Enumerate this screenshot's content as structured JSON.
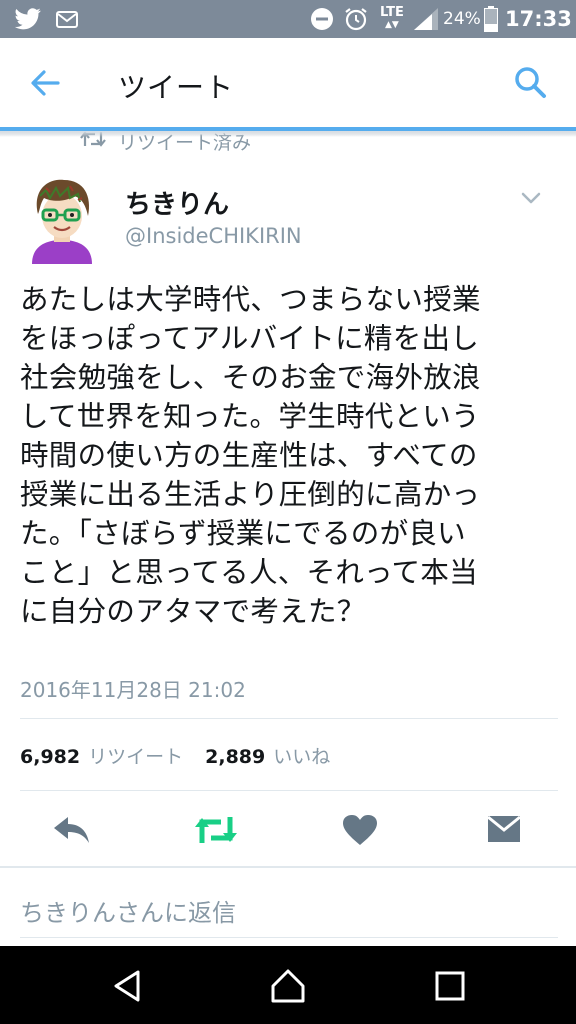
{
  "status_bar": {
    "network": "LTE",
    "battery_percent": "24%",
    "time": "17:33",
    "icons": [
      "twitter-icon",
      "mail-notification-icon",
      "do-not-disturb-icon",
      "alarm-icon",
      "signal-icon",
      "battery-icon"
    ]
  },
  "app_bar": {
    "title": "ツイート",
    "back_icon": "arrow-left-icon",
    "search_icon": "search-icon",
    "accent_color": "#55acee"
  },
  "retweet_context": {
    "label": "リツイート済み"
  },
  "tweet": {
    "author_name": "ちきりん",
    "author_handle": "@InsideCHIKIRIN",
    "text": "あたしは大学時代、つまらない授業\nをほっぽってアルバイトに精を出し\n社会勉強をし、そのお金で海外放浪\nして世界を知った。学生時代という\n時間の使い方の生産性は、すべての\n授業に出る生活より圧倒的に高かっ\nた。「さぼらず授業にでるのが良い\nこと」と思ってる人、それって本当\nに自分のアタマで考えた？",
    "timestamp": "2016年11月28日 21:02",
    "retweet_count": "6,982",
    "retweet_label": "リツイート",
    "like_count": "2,889",
    "like_label": "いいね"
  },
  "actions": {
    "icons": [
      "reply-icon",
      "retweet-icon",
      "heart-icon",
      "direct-message-icon"
    ],
    "retweet_active_color": "#19cf86"
  },
  "reply": {
    "placeholder": "ちきりんさんに返信"
  },
  "nav_bar": {
    "icons": [
      "back-triangle-icon",
      "home-icon",
      "recents-icon"
    ]
  }
}
